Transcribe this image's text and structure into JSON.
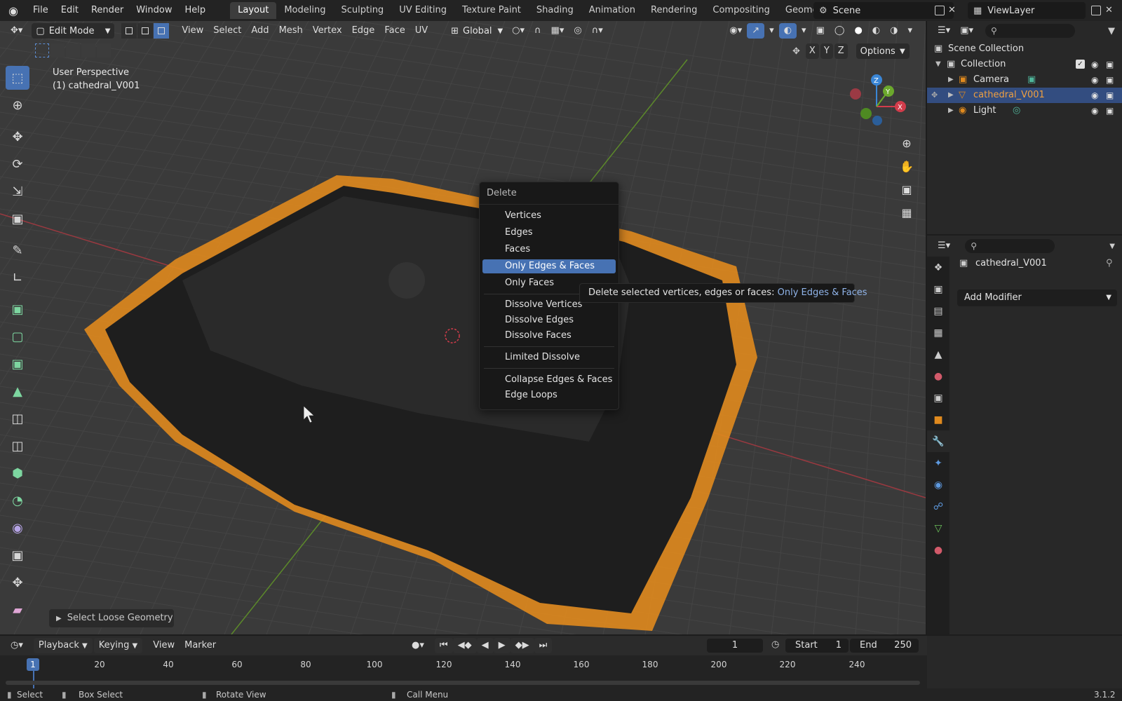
{
  "menubar": {
    "items": [
      "File",
      "Edit",
      "Render",
      "Window",
      "Help"
    ],
    "workspaces": [
      "Layout",
      "Modeling",
      "Sculpting",
      "UV Editing",
      "Texture Paint",
      "Shading",
      "Animation",
      "Rendering",
      "Compositing",
      "Geometry Nodes"
    ],
    "scene": "Scene",
    "view_layer": "ViewLayer"
  },
  "viewport_header": {
    "mode": "Edit Mode",
    "menus": [
      "View",
      "Select",
      "Add",
      "Mesh",
      "Vertex",
      "Edge",
      "Face",
      "UV"
    ],
    "orientation": "Global",
    "options": "Options",
    "axes": [
      "X",
      "Y",
      "Z"
    ]
  },
  "viewport": {
    "view_name": "User Perspective",
    "object_label": "(1) cathedral_V001",
    "gizmo_axes": [
      "Z",
      "Y",
      "X"
    ]
  },
  "delete_menu": {
    "title": "Delete",
    "items": [
      "Vertices",
      "Edges",
      "Faces",
      "Only Edges & Faces",
      "Only Faces",
      "Dissolve Vertices",
      "Dissolve Edges",
      "Dissolve Faces",
      "Limited Dissolve",
      "Collapse Edges & Faces",
      "Edge Loops"
    ],
    "highlighted": "Only Edges & Faces"
  },
  "tooltip": {
    "text": "Delete selected vertices, edges or faces:",
    "value": "Only Edges & Faces"
  },
  "last_operator": "Select Loose Geometry",
  "outliner": {
    "root": "Scene Collection",
    "collection": "Collection",
    "objects": [
      "Camera",
      "cathedral_V001",
      "Light"
    ]
  },
  "properties": {
    "object_name": "cathedral_V001",
    "add_modifier": "Add Modifier"
  },
  "timeline": {
    "menus": [
      "Playback",
      "Keying",
      "View",
      "Marker"
    ],
    "current_frame": "1",
    "start_label": "Start",
    "start": "1",
    "end_label": "End",
    "end": "250",
    "ticks": [
      "20",
      "40",
      "60",
      "80",
      "100",
      "120",
      "140",
      "160",
      "180",
      "200",
      "220",
      "240"
    ],
    "playhead": "1"
  },
  "statusbar": {
    "select": "Select",
    "box_select": "Box Select",
    "rotate_view": "Rotate View",
    "call_menu": "Call Menu",
    "version": "3.1.2"
  },
  "colors": {
    "accent": "#4772b3",
    "selected_points": "#e08a1e",
    "x_axis": "#d23c4b",
    "y_axis": "#6ba82c",
    "z_axis": "#3a86d6"
  }
}
